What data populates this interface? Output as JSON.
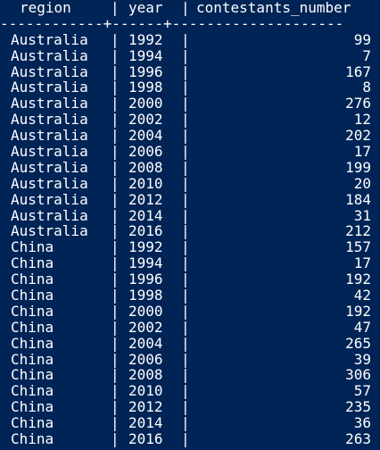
{
  "table": {
    "header": {
      "region": "region",
      "year": "year",
      "contestants_number": "contestants_number"
    },
    "separator": "------------+------+--------------------",
    "rows": [
      {
        "region": "Australia",
        "year": "1992",
        "contestants_number": "99"
      },
      {
        "region": "Australia",
        "year": "1994",
        "contestants_number": "7"
      },
      {
        "region": "Australia",
        "year": "1996",
        "contestants_number": "167"
      },
      {
        "region": "Australia",
        "year": "1998",
        "contestants_number": "8"
      },
      {
        "region": "Australia",
        "year": "2000",
        "contestants_number": "276"
      },
      {
        "region": "Australia",
        "year": "2002",
        "contestants_number": "12"
      },
      {
        "region": "Australia",
        "year": "2004",
        "contestants_number": "202"
      },
      {
        "region": "Australia",
        "year": "2006",
        "contestants_number": "17"
      },
      {
        "region": "Australia",
        "year": "2008",
        "contestants_number": "199"
      },
      {
        "region": "Australia",
        "year": "2010",
        "contestants_number": "20"
      },
      {
        "region": "Australia",
        "year": "2012",
        "contestants_number": "184"
      },
      {
        "region": "Australia",
        "year": "2014",
        "contestants_number": "31"
      },
      {
        "region": "Australia",
        "year": "2016",
        "contestants_number": "212"
      },
      {
        "region": "China",
        "year": "1992",
        "contestants_number": "157"
      },
      {
        "region": "China",
        "year": "1994",
        "contestants_number": "17"
      },
      {
        "region": "China",
        "year": "1996",
        "contestants_number": "192"
      },
      {
        "region": "China",
        "year": "1998",
        "contestants_number": "42"
      },
      {
        "region": "China",
        "year": "2000",
        "contestants_number": "192"
      },
      {
        "region": "China",
        "year": "2002",
        "contestants_number": "47"
      },
      {
        "region": "China",
        "year": "2004",
        "contestants_number": "265"
      },
      {
        "region": "China",
        "year": "2006",
        "contestants_number": "39"
      },
      {
        "region": "China",
        "year": "2008",
        "contestants_number": "306"
      },
      {
        "region": "China",
        "year": "2010",
        "contestants_number": "57"
      },
      {
        "region": "China",
        "year": "2012",
        "contestants_number": "235"
      },
      {
        "region": "China",
        "year": "2014",
        "contestants_number": "36"
      },
      {
        "region": "China",
        "year": "2016",
        "contestants_number": "263"
      }
    ]
  },
  "colors": {
    "background": "#012456",
    "text": "#ffffff"
  }
}
